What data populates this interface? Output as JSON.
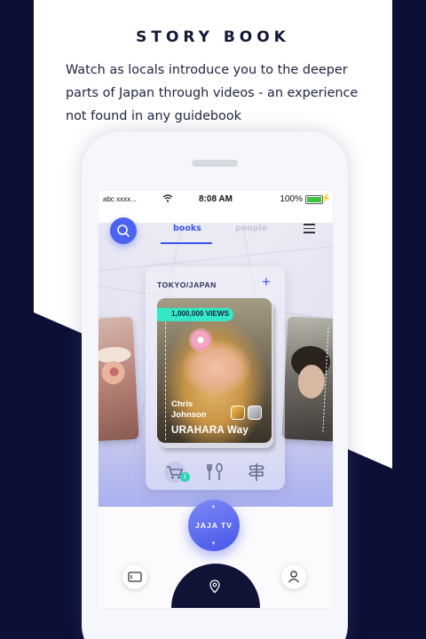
{
  "page": {
    "title": "STORY BOOK",
    "description": "Watch as locals introduce you to the deeper parts of Japan through videos - an experience not found in any guidebook"
  },
  "colors": {
    "navy": "#0c1037",
    "accent": "#4c63f1",
    "teal": "#34e8c6"
  },
  "status_bar": {
    "carrier": "abc xxxx...",
    "time": "8:08 AM",
    "battery": "100%"
  },
  "header": {
    "search_icon": "search-icon",
    "tabs": [
      {
        "label": "books",
        "active": true
      },
      {
        "label": "people",
        "active": false
      }
    ],
    "menu_icon": "hamburger-menu-icon"
  },
  "story_card": {
    "location": "TOKYO/JAPAN",
    "add_icon": "plus-icon",
    "views": "1,000,000 VIEWS",
    "author_first": "Chris",
    "author_last": "Johnson",
    "title": "URAHARA Way"
  },
  "categories": [
    {
      "icon": "shopping-cart-icon",
      "badge": "1"
    },
    {
      "icon": "fork-spoon-icon"
    },
    {
      "icon": "signpost-icon"
    }
  ],
  "bottom_nav": {
    "center_label": "JAJA TV",
    "left_icon": "tv-icon",
    "center_icon": "location-pin-icon",
    "right_icon": "user-icon"
  }
}
